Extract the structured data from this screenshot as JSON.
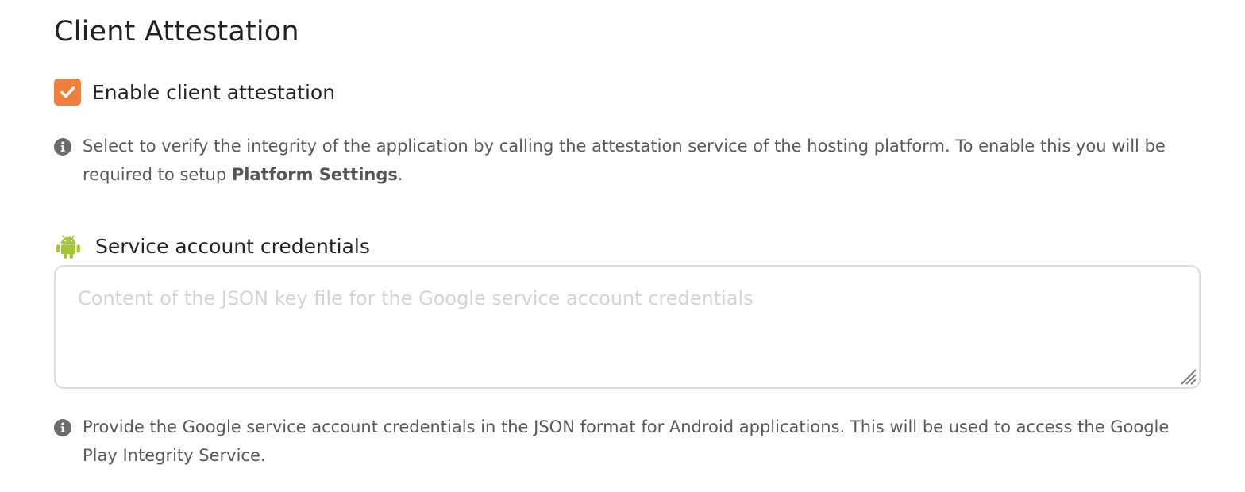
{
  "section": {
    "title": "Client Attestation"
  },
  "enable_checkbox": {
    "label": "Enable client attestation",
    "checked": true,
    "color": "#f07f3c"
  },
  "attestation_info": {
    "text_before": "Select to verify the integrity of the application by calling the attestation service of the hosting platform. To enable this you will be required to setup ",
    "strong": "Platform Settings",
    "text_after": ".",
    "icon": "info-icon"
  },
  "credentials_field": {
    "icon": "android-icon",
    "icon_color": "#a4c639",
    "label": "Service account credentials",
    "value": "",
    "placeholder": "Content of the JSON key file for the Google service account credentials"
  },
  "credentials_info": {
    "text": "Provide the Google service account credentials in the JSON format for Android applications. This will be used to access the Google Play Integrity Service.",
    "icon": "info-icon"
  }
}
